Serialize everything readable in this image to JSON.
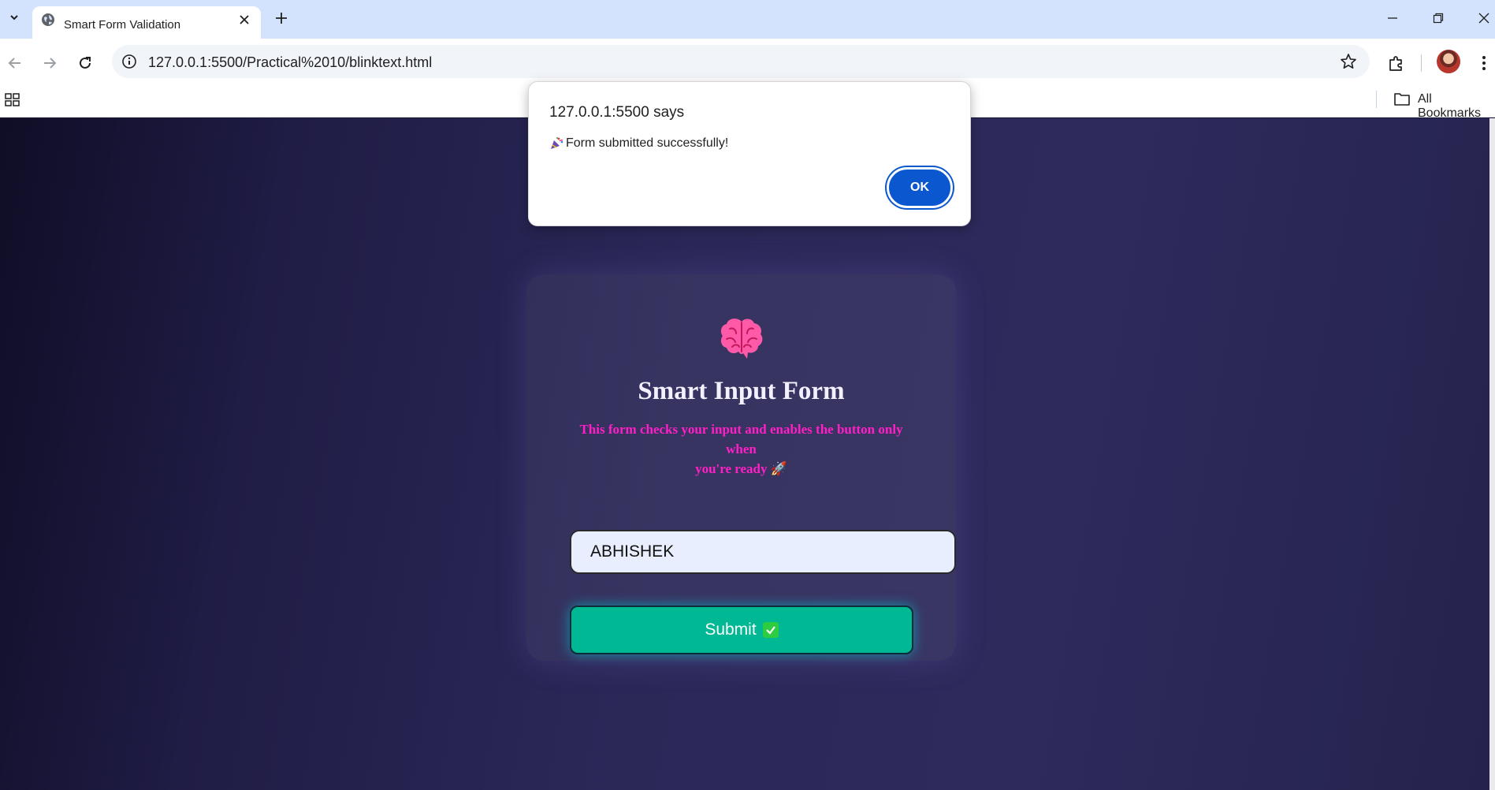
{
  "browser": {
    "tab_title": "Smart Form Validation",
    "url": "127.0.0.1:5500/Practical%2010/blinktext.html",
    "bookmarks_label": "All Bookmarks"
  },
  "form": {
    "title": "Smart Input Form",
    "subtitle_line1": "This form checks your input and enables the button only when",
    "subtitle_line2": "you're ready 🚀",
    "input_value": "ABHISHEK",
    "submit_label": "Submit"
  },
  "dialog": {
    "title": "127.0.0.1:5500 says",
    "message": "Form submitted successfully!",
    "ok_label": "OK"
  },
  "colors": {
    "accent_pink": "#ff1fc6",
    "submit_green": "#00b894",
    "dialog_blue": "#0b57d0"
  }
}
